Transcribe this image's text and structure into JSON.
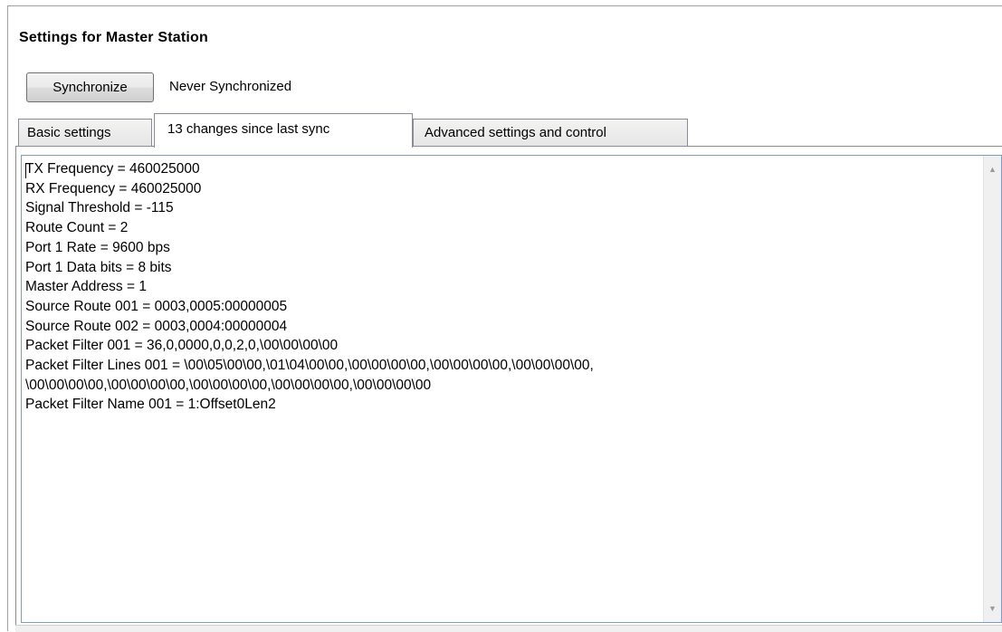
{
  "panel": {
    "title": "Settings for Master Station"
  },
  "sync": {
    "button_label": "Synchronize",
    "status": "Never Synchronized"
  },
  "tabs": [
    {
      "label": "Basic settings",
      "selected": false
    },
    {
      "label": "13 changes since last sync",
      "selected": true
    },
    {
      "label": "Advanced settings and control",
      "selected": false
    }
  ],
  "changes_text": {
    "lines": [
      "TX Frequency = 460025000",
      "RX Frequency = 460025000",
      "Signal Threshold = -115",
      "Route Count = 2",
      "Port 1 Rate = 9600 bps",
      "Port 1 Data bits = 8 bits",
      "Master Address = 1",
      "Source Route 001 = 0003,0005:00000005",
      "Source Route 002 = 0003,0004:00000004",
      "Packet Filter 001 = 36,0,0000,0,0,2,0,\\00\\00\\00\\00",
      "Packet Filter Lines 001 = \\00\\05\\00\\00,\\01\\04\\00\\00,\\00\\00\\00\\00,\\00\\00\\00\\00,\\00\\00\\00\\00,",
      "\\00\\00\\00\\00,\\00\\00\\00\\00,\\00\\00\\00\\00,\\00\\00\\00\\00,\\00\\00\\00\\00",
      "Packet Filter Name 001 = 1:Offset0Len2"
    ]
  },
  "scrollbar": {
    "up_icon": "▲",
    "down_icon": "▼"
  }
}
